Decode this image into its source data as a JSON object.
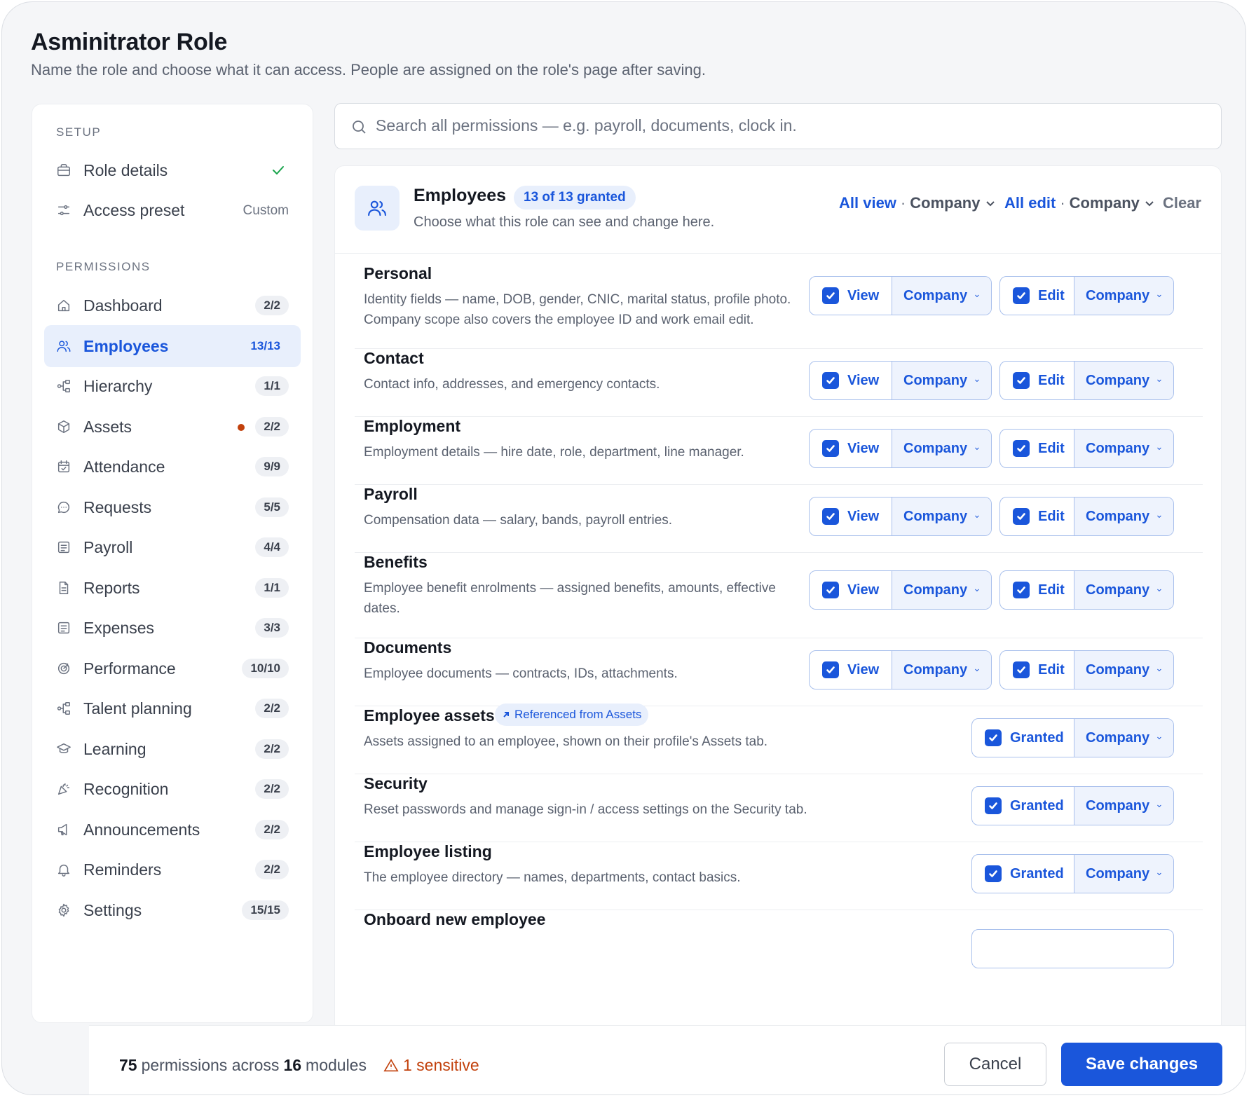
{
  "page": {
    "title": "Asminitrator Role",
    "subtitle": "Name the role and choose what it can access. People are assigned on the role's page after saving."
  },
  "sidebar": {
    "setup_label": "SETUP",
    "role_details": "Role details",
    "access_preset": "Access preset",
    "access_preset_value": "Custom",
    "permissions_label": "PERMISSIONS",
    "items": [
      {
        "label": "Dashboard",
        "count": "2/2",
        "icon": "home-icon"
      },
      {
        "label": "Employees",
        "count": "13/13",
        "icon": "users-icon"
      },
      {
        "label": "Hierarchy",
        "count": "1/1",
        "icon": "hierarchy-icon"
      },
      {
        "label": "Assets",
        "count": "2/2",
        "icon": "box-icon"
      },
      {
        "label": "Attendance",
        "count": "9/9",
        "icon": "calendar-icon"
      },
      {
        "label": "Requests",
        "count": "5/5",
        "icon": "chat-icon"
      },
      {
        "label": "Payroll",
        "count": "4/4",
        "icon": "receipt-icon"
      },
      {
        "label": "Reports",
        "count": "1/1",
        "icon": "file-icon"
      },
      {
        "label": "Expenses",
        "count": "3/3",
        "icon": "receipt-icon"
      },
      {
        "label": "Performance",
        "count": "10/10",
        "icon": "target-icon"
      },
      {
        "label": "Talent planning",
        "count": "2/2",
        "icon": "hierarchy-icon"
      },
      {
        "label": "Learning",
        "count": "2/2",
        "icon": "graduation-cap-icon"
      },
      {
        "label": "Recognition",
        "count": "2/2",
        "icon": "party-icon"
      },
      {
        "label": "Announcements",
        "count": "2/2",
        "icon": "megaphone-icon"
      },
      {
        "label": "Reminders",
        "count": "2/2",
        "icon": "bell-icon"
      },
      {
        "label": "Settings",
        "count": "15/15",
        "icon": "gear-icon"
      }
    ],
    "active": "Employees",
    "warning_color": "#c2410c"
  },
  "search": {
    "placeholder": "Search all permissions — e.g. payroll, documents, clock in."
  },
  "module": {
    "title": "Employees",
    "badge": "13 of 13 granted",
    "subtitle": "Choose what this role can see and change here.",
    "bulk_view": "All view",
    "bulk_view_scope": "Company",
    "bulk_edit": "All edit",
    "bulk_edit_scope": "Company",
    "bulk_sep": "·",
    "clear": "Clear",
    "rows": [
      {
        "title": "Personal",
        "desc": "Identity fields — name, DOB, gender, CNIC, marital status, profile photo. Company scope also covers the employee ID and work email edit.",
        "view": "View",
        "view_scope": "Company",
        "edit": "Edit",
        "edit_scope": "Company"
      },
      {
        "title": "Contact",
        "desc": "Contact info, addresses, and emergency contacts.",
        "view": "View",
        "view_scope": "Company",
        "edit": "Edit",
        "edit_scope": "Company"
      },
      {
        "title": "Employment",
        "desc": "Employment details — hire date, role, department, line manager.",
        "view": "View",
        "view_scope": "Company",
        "edit": "Edit",
        "edit_scope": "Company"
      },
      {
        "title": "Payroll",
        "desc": "Compensation data — salary, bands, payroll entries.",
        "view": "View",
        "view_scope": "Company",
        "edit": "Edit",
        "edit_scope": "Company"
      },
      {
        "title": "Benefits",
        "desc": "Employee benefit enrolments — assigned benefits, amounts, effective dates.",
        "view": "View",
        "view_scope": "Company",
        "edit": "Edit",
        "edit_scope": "Company"
      },
      {
        "title": "Documents",
        "desc": "Employee documents — contracts, IDs, attachments.",
        "view": "View",
        "view_scope": "Company",
        "edit": "Edit",
        "edit_scope": "Company"
      },
      {
        "title": "Employee assets",
        "badge": "Referenced from Assets",
        "desc": "Assets assigned to an employee, shown on their profile's Assets tab.",
        "grant": "Granted",
        "grant_scope": "Company"
      },
      {
        "title": "Security",
        "desc": "Reset passwords and manage sign-in / access settings on the Security tab.",
        "grant": "Granted",
        "grant_scope": "Company"
      },
      {
        "title": "Employee listing",
        "desc": "The employee directory — names, departments, contact basics.",
        "grant": "Granted",
        "grant_scope": "Company"
      },
      {
        "title": "Onboard new employee"
      }
    ]
  },
  "footer": {
    "count_permissions": "75",
    "text_permissions": "permissions across",
    "count_modules": "16",
    "text_modules": "modules",
    "sensitive": "1 sensitive",
    "cancel": "Cancel",
    "save": "Save changes"
  },
  "colors": {
    "accent": "#1a56db",
    "warning": "#c2410c"
  }
}
